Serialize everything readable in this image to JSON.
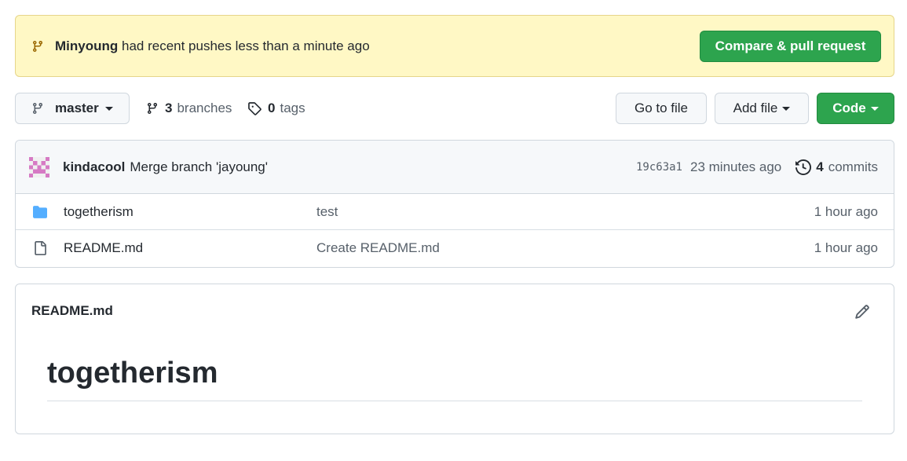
{
  "banner": {
    "user": "Minyoung",
    "message": " had recent pushes less than a minute ago",
    "button_label": "Compare & pull request"
  },
  "toolbar": {
    "branch": "master",
    "branches_count": "3",
    "branches_label": "branches",
    "tags_count": "0",
    "tags_label": "tags",
    "go_to_file": "Go to file",
    "add_file": "Add file",
    "code": "Code"
  },
  "commit": {
    "author": "kindacool",
    "message": "Merge branch 'jayoung'",
    "sha": "19c63a1",
    "time": "23 minutes ago",
    "commits_count": "4",
    "commits_label": "commits"
  },
  "files": [
    {
      "name": "togetherism",
      "type": "folder-icon",
      "message": "test",
      "age": "1 hour ago"
    },
    {
      "name": "README.md",
      "type": "file-icon",
      "message": "Create README.md",
      "age": "1 hour ago"
    }
  ],
  "readme": {
    "header": "README.md",
    "title": "togetherism"
  },
  "colors": {
    "banner_bg": "#fff8c5",
    "primary_green": "#2da44e",
    "folder_blue": "#54aeff"
  }
}
